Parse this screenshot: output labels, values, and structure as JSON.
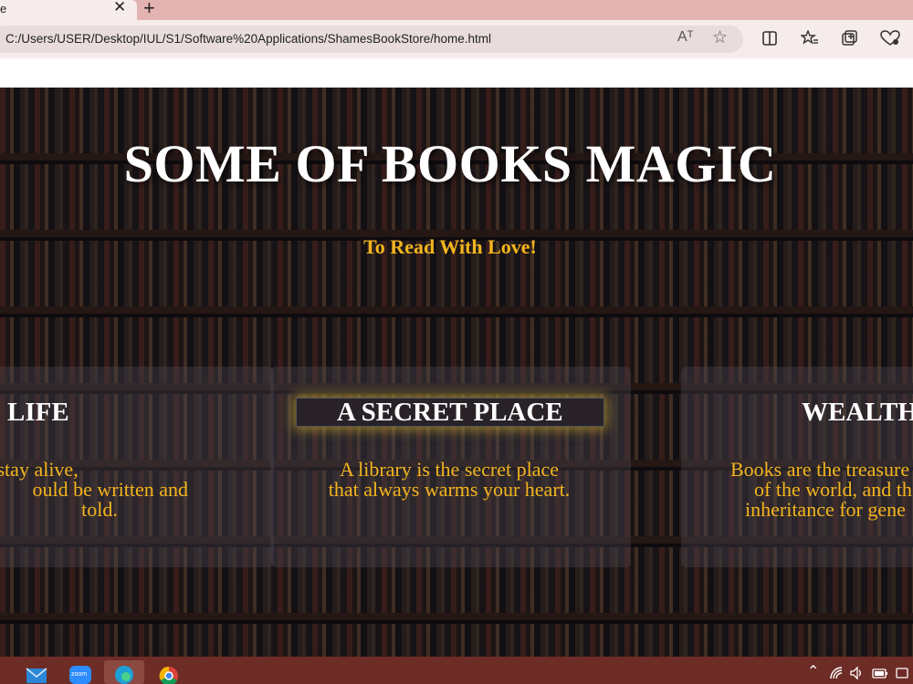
{
  "browser": {
    "tab_title": "e",
    "tab_close": "✕",
    "new_tab": "+",
    "url": "C:/Users/USER/Desktop/IUL/S1/Software%20Applications/ShamesBookStore/home.html",
    "read_aloud": "Aᵀ",
    "favorite": "☆"
  },
  "hero": {
    "title": "SOME OF BOOKS MAGIC",
    "subtitle": "To Read With Love!"
  },
  "cards": [
    {
      "title": "LIFE",
      "lines": [
        "o stay alive,",
        "ould be written and",
        "told."
      ]
    },
    {
      "title": "A SECRET PLACE",
      "lines": [
        "A library is the secret place",
        "that always warms your heart."
      ]
    },
    {
      "title": "WEALTH",
      "lines": [
        "Books are the treasure",
        "of the world, and th",
        "inheritance for gene"
      ]
    }
  ],
  "taskbar": {
    "zoom_label": "zoom",
    "tray_up": "⌃"
  },
  "colors": {
    "accent_gold": "#f3b51d",
    "tabstrip": "#e3b3b1",
    "taskbar": "#6e2c26"
  }
}
